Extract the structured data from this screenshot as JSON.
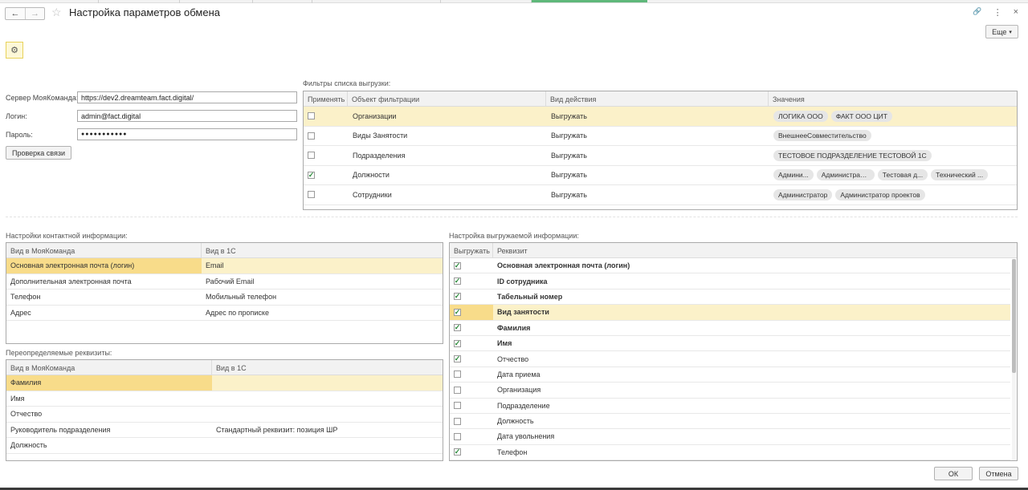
{
  "header": {
    "back_icon": "←",
    "forward_icon": "→",
    "star_icon": "☆",
    "title": "Настройка параметров обмена",
    "link_icon": "🔗",
    "menu_icon": "⋮",
    "close_icon": "×",
    "more_label": "Еще",
    "more_caret": "▾"
  },
  "settings_button": {
    "icon": "⚙"
  },
  "connection": {
    "server_label": "Сервер МояКоманда:",
    "server_value": "https://dev2.dreamteam.fact.digital/",
    "login_label": "Логин:",
    "login_value": "admin@fact.digital",
    "password_label": "Пароль:",
    "password_value": "●●●●●●●●●●●",
    "check_button": "Проверка связи"
  },
  "filters": {
    "title": "Фильтры списка выгрузки:",
    "headers": [
      "Применять",
      "Объект фильтрации",
      "Вид действия",
      "Значения"
    ],
    "rows": [
      {
        "checked": "",
        "object": "Организации",
        "action": "Выгружать",
        "values": [
          "ЛОГИКА ООО",
          "ФАКТ ООО ЦИТ"
        ]
      },
      {
        "checked": "",
        "object": "Виды Занятости",
        "action": "Выгружать",
        "values": [
          "ВнешнееСовместительство"
        ]
      },
      {
        "checked": "",
        "object": "Подразделения",
        "action": "Выгружать",
        "values": [
          "ТЕСТОВОЕ ПОДРАЗДЕЛЕНИЕ ТЕСТОВОЙ 1С"
        ]
      },
      {
        "checked": "✓",
        "object": "Должности",
        "action": "Выгружать",
        "values": [
          "Админи...",
          "Администрато...",
          "Тестовая д...",
          "Технический ..."
        ]
      },
      {
        "checked": "",
        "object": "Сотрудники",
        "action": "Выгружать",
        "values": [
          "Администратор",
          "Администратор проектов"
        ]
      }
    ]
  },
  "contact": {
    "title": "Настройки контактной информации:",
    "headers": [
      "Вид в МояКоманда",
      "Вид в 1С"
    ],
    "rows": [
      {
        "mk": "Основная электронная почта (логин)",
        "c1": "Email"
      },
      {
        "mk": "Дополнительная электронная почта",
        "c1": "Рабочий Email"
      },
      {
        "mk": "Телефон",
        "c1": "Мобильный телефон"
      },
      {
        "mk": "Адрес",
        "c1": "Адрес по прописке"
      }
    ]
  },
  "override": {
    "title": "Переопределяемые реквизиты:",
    "headers": [
      "Вид в МояКоманда",
      "Вид в 1С"
    ],
    "rows": [
      {
        "mk": "Фамилия",
        "c1": ""
      },
      {
        "mk": "Имя",
        "c1": ""
      },
      {
        "mk": "Отчество",
        "c1": ""
      },
      {
        "mk": "Руководитель подразделения",
        "c1": "Стандартный реквизит: позиция ШР"
      },
      {
        "mk": "Должность",
        "c1": ""
      }
    ]
  },
  "export": {
    "title": "Настройка выгружаемой информации:",
    "headers": [
      "Выгружать",
      "Реквизит"
    ],
    "rows": [
      {
        "checked": "✓",
        "name": "Основная электронная почта (логин)"
      },
      {
        "checked": "✓",
        "name": "ID сотрудника"
      },
      {
        "checked": "✓",
        "name": "Табельный номер"
      },
      {
        "checked": "✓",
        "name": "Вид занятости"
      },
      {
        "checked": "✓",
        "name": "Фамилия"
      },
      {
        "checked": "✓",
        "name": "Имя"
      },
      {
        "checked": "✓",
        "name": "Отчество"
      },
      {
        "checked": "",
        "name": "Дата приема"
      },
      {
        "checked": "",
        "name": "Организация"
      },
      {
        "checked": "",
        "name": "Подразделение"
      },
      {
        "checked": "",
        "name": "Должность"
      },
      {
        "checked": "",
        "name": "Дата увольнения"
      },
      {
        "checked": "✓",
        "name": "Телефон"
      }
    ]
  },
  "footer": {
    "ok": "ОК",
    "cancel": "Отмена"
  }
}
